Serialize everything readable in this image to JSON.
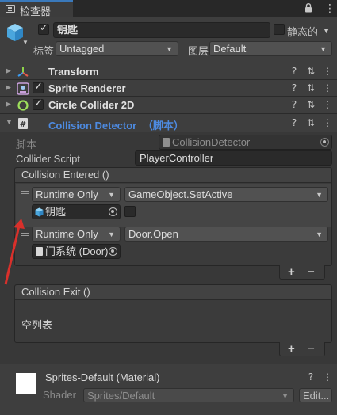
{
  "window": {
    "tab_title": "检查器"
  },
  "object": {
    "name": "钥匙",
    "static_label": "静态的",
    "tag_label": "标签",
    "tag_value": "Untagged",
    "layer_label": "图层",
    "layer_value": "Default"
  },
  "components": [
    {
      "name": "Transform"
    },
    {
      "name": "Sprite Renderer"
    },
    {
      "name": "Circle Collider 2D"
    },
    {
      "name": "Collision Detector",
      "suffix": "（脚本）"
    }
  ],
  "script_fields": {
    "script_label": "脚本",
    "script_value": "CollisionDetector",
    "collider_label": "Collider Script",
    "collider_value": "PlayerController"
  },
  "event_entered": {
    "header": "Collision Entered ()",
    "entries": [
      {
        "mode": "Runtime Only",
        "function": "GameObject.SetActive",
        "target": "钥匙",
        "has_bool": true
      },
      {
        "mode": "Runtime Only",
        "function": "Door.Open",
        "target": "门系统 (Door)",
        "has_bool": false
      }
    ]
  },
  "event_exit": {
    "header": "Collision Exit ()",
    "empty_text": "空列表"
  },
  "material": {
    "name": "Sprites-Default (Material)",
    "shader_label": "Shader",
    "shader_value": "Sprites/Default",
    "edit_label": "Edit..."
  },
  "buttons": {
    "plus": "+",
    "minus": "−"
  },
  "colors": {
    "accent_blue": "#4d8ae0",
    "arrow_red": "#d9302b"
  }
}
